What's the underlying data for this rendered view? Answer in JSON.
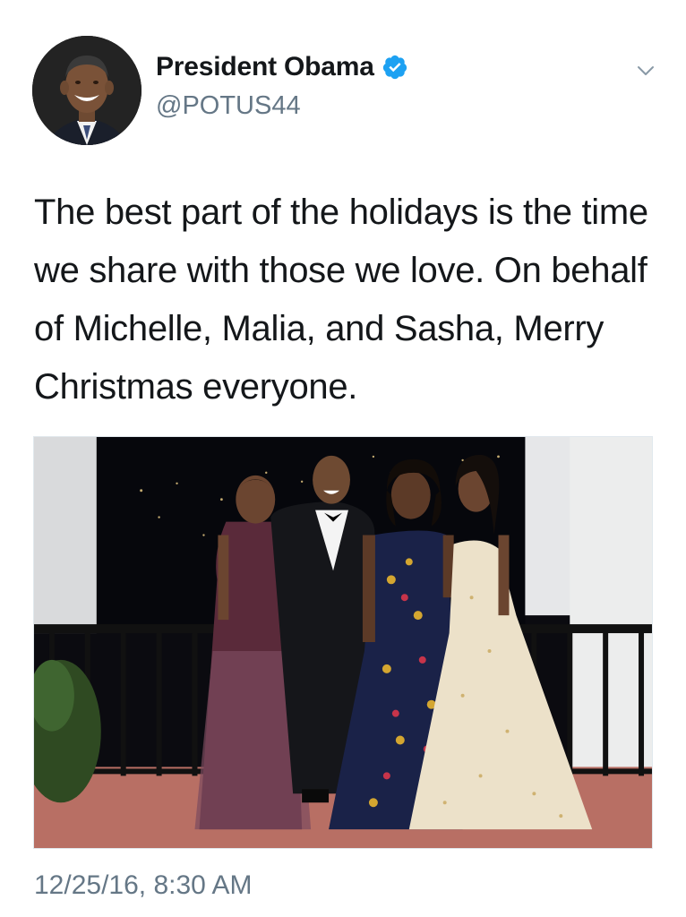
{
  "author": {
    "display_name": "President Obama",
    "handle": "@POTUS44",
    "avatar_icon": "avatar-portrait",
    "verified_icon": "verified-badge-icon",
    "verified_color": "#1da1f2"
  },
  "tweet": {
    "text": "The best part of the holidays is the time we share with those we love. On behalf of Michelle, Malia, and Sasha, Merry Christmas everyone.",
    "timestamp": "12/25/16, 8:30 AM"
  },
  "menu": {
    "icon": "chevron-down-icon"
  },
  "colors": {
    "text_primary": "#14171a",
    "text_secondary": "#657786",
    "accent": "#1da1f2"
  }
}
